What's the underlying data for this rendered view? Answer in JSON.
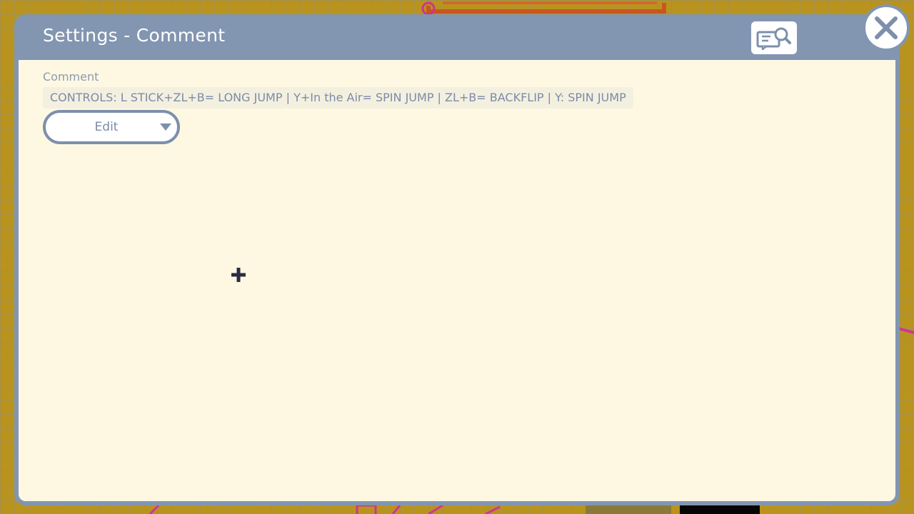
{
  "dialog": {
    "title": "Settings - Comment",
    "help_icon": "manual-search-icon",
    "close_icon": "close-x-icon"
  },
  "comment": {
    "label": "Comment",
    "value": "CONTROLS: L STICK+ZL+B= LONG JUMP | Y+In the Air= SPIN JUMP | ZL+B= BACKFLIP | Y: SPIN JUMP"
  },
  "edit_select": {
    "label": "Edit",
    "icon": "chevron-down-icon"
  },
  "cursor": {
    "icon": "crosshair-cursor-icon"
  },
  "colors": {
    "background": "#b8941f",
    "dialog_frame": "#8295b1",
    "dialog_body": "#fef8e3",
    "text_muted": "#7b8ba7",
    "white": "#ffffff"
  }
}
